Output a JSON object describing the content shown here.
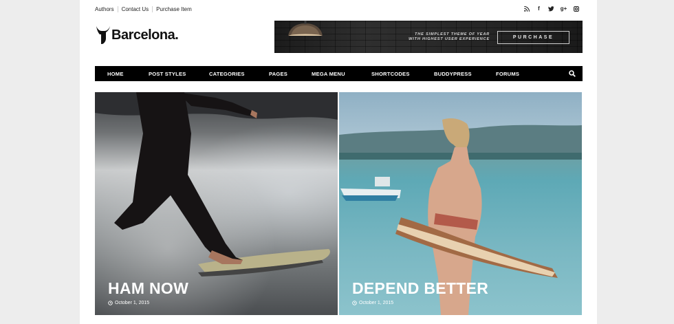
{
  "topbar": {
    "links": [
      "Authors",
      "Contact Us",
      "Purchase Item"
    ]
  },
  "social_icons": [
    "rss-icon",
    "facebook-icon",
    "twitter-icon",
    "google-plus-icon",
    "instagram-icon"
  ],
  "logo": {
    "text": "Barcelona."
  },
  "banner": {
    "line1": "THE SIMPLEST THEME OF YEAR",
    "line2": "WITH HIGHEST USER EXPERIENCE",
    "button": "PURCHASE"
  },
  "nav": {
    "items": [
      "HOME",
      "POST STYLES",
      "CATEGORIES",
      "PAGES",
      "MEGA MENU",
      "SHORTCODES",
      "BUDDYPRESS",
      "FORUMS"
    ]
  },
  "posts": [
    {
      "title": "HAM NOW",
      "date": "October 1, 2015"
    },
    {
      "title": "DEPEND BETTER",
      "date": "October 1, 2015"
    }
  ],
  "colors": {
    "nav_bg": "#000000",
    "page_bg": "#ffffff",
    "outer_bg": "#ededed"
  }
}
